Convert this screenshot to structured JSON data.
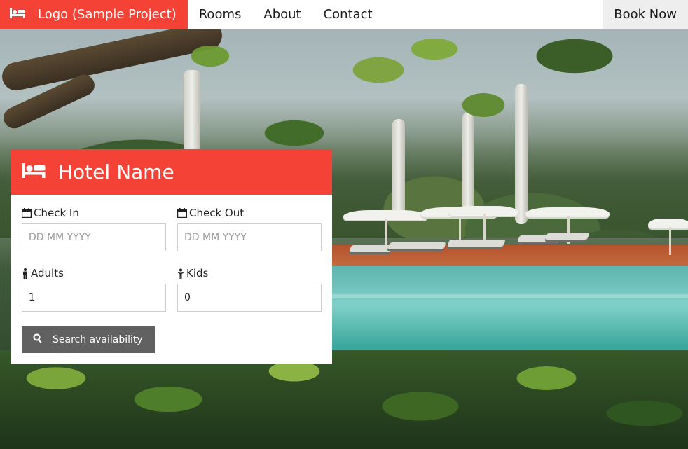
{
  "nav": {
    "brand_label": "Logo (Sample Project)",
    "links": [
      "Rooms",
      "About",
      "Contact"
    ],
    "cta_label": "Book Now"
  },
  "card": {
    "title": "Hotel Name",
    "check_in": {
      "label": "Check In",
      "placeholder": "DD MM YYYY"
    },
    "check_out": {
      "label": "Check Out",
      "placeholder": "DD MM YYYY"
    },
    "adults": {
      "label": "Adults",
      "value": "1"
    },
    "kids": {
      "label": "Kids",
      "value": "0"
    },
    "search_label": "Search availability"
  },
  "icons": {
    "brand": "bed-icon",
    "header": "bed-icon",
    "check_in": "calendar-icon",
    "check_out": "calendar-icon",
    "adults": "male-icon",
    "kids": "child-icon",
    "search": "search-icon"
  },
  "colors": {
    "accent": "#f44336",
    "button": "#616161",
    "cta_bg": "#eeeeee"
  }
}
